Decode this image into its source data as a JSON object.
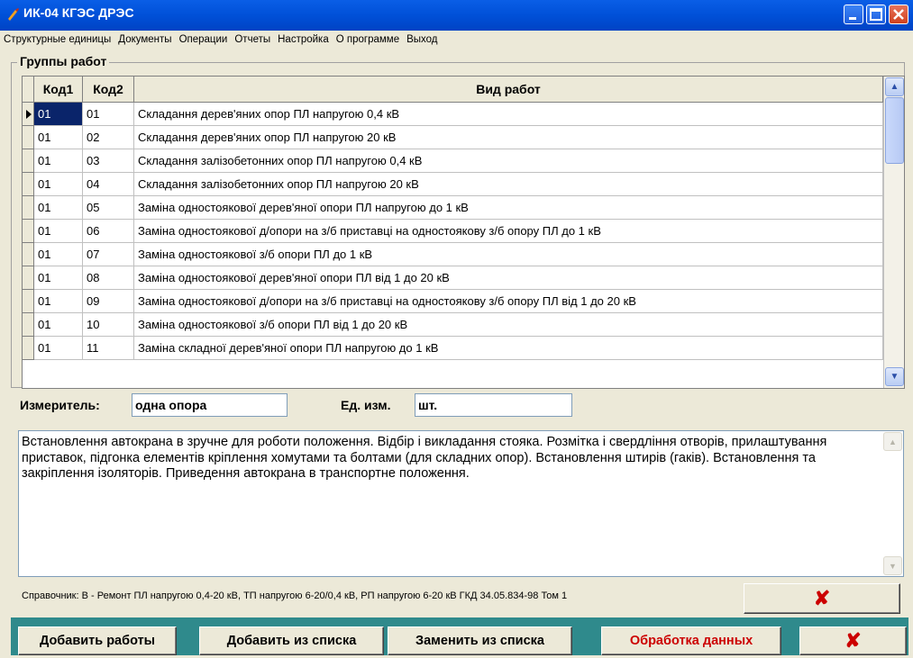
{
  "window": {
    "title": "ИК-04 КГЭС ДРЭС"
  },
  "menu": [
    "Структурные единицы",
    "Документы",
    "Операции",
    "Отчеты",
    "Настройка",
    "О программе",
    "Выход"
  ],
  "group": {
    "title": "Группы работ"
  },
  "grid": {
    "columns": [
      "Код1",
      "Код2",
      "Вид работ"
    ],
    "rows": [
      [
        "01",
        "01",
        "Складання дерев'яних опор ПЛ напругою 0,4 кВ"
      ],
      [
        "01",
        "02",
        "Складання дерев'яних опор ПЛ напругою 20 кВ"
      ],
      [
        "01",
        "03",
        "Складання залізобетонних опор ПЛ напругою 0,4 кВ"
      ],
      [
        "01",
        "04",
        "Складання залізобетонних опор ПЛ напругою 20 кВ"
      ],
      [
        "01",
        "05",
        "Заміна одностоякової дерев'яної опори ПЛ напругою до 1 кВ"
      ],
      [
        "01",
        "06",
        "Заміна одностоякової д/опори на з/б приставці на одностоякову з/б опору ПЛ  до 1 кВ"
      ],
      [
        "01",
        "07",
        "Заміна одностоякової з/б опори ПЛ  до 1 кВ"
      ],
      [
        "01",
        "08",
        "Заміна одностоякової дерев'яної опори ПЛ  від 1 до 20 кВ"
      ],
      [
        "01",
        "09",
        "Заміна одностоякової д/опори на з/б приставці на одностоякову з/б опору ПЛ  від 1 до 20 кВ"
      ],
      [
        "01",
        "10",
        "Заміна одностоякової з/б опори ПЛ  від 1 до 20 кВ"
      ],
      [
        "01",
        "11",
        "Заміна складної дерев'яної опори ПЛ напругою до 1 кВ"
      ]
    ]
  },
  "measure": {
    "label": "Измеритель:",
    "value": "одна опора",
    "unit_label": "Ед. изм.",
    "unit_value": "шт."
  },
  "description": "Встановлення автокрана в зручне для роботи положення. Відбір і викладання стояка. Розмітка і свердління отворів, прилаштування приставок, підгонка елементів кріплення хомутами та болтами (для складних опор). Встановлення штирів (гаків). Встановлення та закріплення ізоляторів. Приведення автокрана в транспортне положення.",
  "reference": "Справочник: В - Ремонт ПЛ напругою 0,4-20 кВ, ТП напругою 6-20/0,4 кВ, РП напругою 6-20 кВ ГКД 34.05.834-98 Том 1",
  "buttons": {
    "add_works": "Добавить работы",
    "add_from_list": "Добавить из списка",
    "replace_from_list": "Заменить из списка",
    "process_data": "Обработка данных"
  },
  "colors": {
    "process_text": "#cc0000",
    "bottom_panel": "#2f8a8c",
    "selection": "#0a246a"
  },
  "icons": {
    "close_mark": "✘"
  }
}
